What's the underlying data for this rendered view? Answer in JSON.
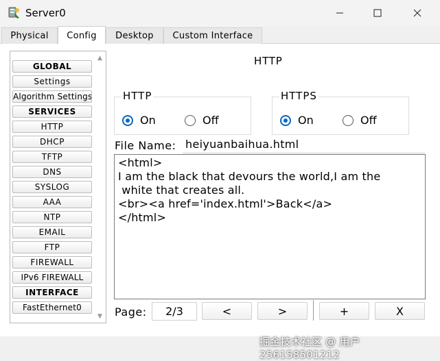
{
  "window": {
    "title": "Server0",
    "icon": "server-icon",
    "controls": {
      "minimize": "—",
      "maximize": "☐",
      "close": "✕"
    }
  },
  "tabs": [
    {
      "label": "Physical",
      "active": false
    },
    {
      "label": "Config",
      "active": true
    },
    {
      "label": "Desktop",
      "active": false
    },
    {
      "label": "Custom Interface",
      "active": false
    }
  ],
  "sidebar": {
    "items": [
      {
        "label": "GLOBAL",
        "header": true
      },
      {
        "label": "Settings"
      },
      {
        "label": "Algorithm Settings"
      },
      {
        "label": "SERVICES",
        "header": true
      },
      {
        "label": "HTTP"
      },
      {
        "label": "DHCP"
      },
      {
        "label": "TFTP"
      },
      {
        "label": "DNS"
      },
      {
        "label": "SYSLOG"
      },
      {
        "label": "AAA"
      },
      {
        "label": "NTP"
      },
      {
        "label": "EMAIL"
      },
      {
        "label": "FTP"
      },
      {
        "label": "FIREWALL"
      },
      {
        "label": "IPv6 FIREWALL"
      },
      {
        "label": "INTERFACE",
        "header": true
      },
      {
        "label": "FastEthernet0"
      }
    ],
    "scroll_up": "▲",
    "scroll_down": "▼"
  },
  "main": {
    "heading": "HTTP",
    "http_group": {
      "label": "HTTP",
      "on_label": "On",
      "off_label": "Off",
      "selected": "On"
    },
    "https_group": {
      "label": "HTTPS",
      "on_label": "On",
      "off_label": "Off",
      "selected": "On"
    },
    "file_name_label": "File Name:",
    "file_name_value": "heiyuanbaihua.html",
    "editor_content": "<html>\nI am the black that devours the world,I am the\n white that creates all.\n<br><a href='index.html'>Back</a>\n</html>",
    "pager": {
      "label": "Page:",
      "page": "2/3",
      "prev": "<",
      "next": ">",
      "add": "+",
      "delete": "X"
    }
  },
  "watermark": "掘金技术社区 @ 用户256158501212",
  "colors": {
    "accent": "#0067c0",
    "background": "#f0f0f0"
  }
}
